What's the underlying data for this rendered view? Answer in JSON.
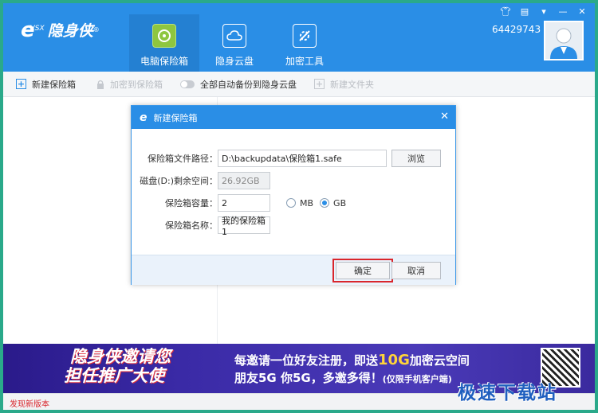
{
  "app": {
    "logo_e": "e",
    "logo_small": "VSX",
    "logo_text": "隐身侠",
    "logo_reg": "®",
    "user_id": "64429743"
  },
  "nav": [
    {
      "label": "电脑保险箱",
      "icon": "safe-icon",
      "active": true
    },
    {
      "label": "隐身云盘",
      "icon": "cloud-icon",
      "active": false
    },
    {
      "label": "加密工具",
      "icon": "tools-icon",
      "active": false
    }
  ],
  "window_controls": [
    "shirt-icon",
    "message-icon",
    "dropdown-icon",
    "minimize-icon",
    "close-icon"
  ],
  "toolbar": {
    "new_safe": "新建保险箱",
    "add_to_safe": "加密到保险箱",
    "auto_backup": "全部自动备份到隐身云盘",
    "new_folder": "新建文件夹"
  },
  "dialog": {
    "title": "新建保险箱",
    "path_label": "保险箱文件路径：",
    "path_value": "D:\\backupdata\\保险箱1.safe",
    "browse": "浏览",
    "disk_label": "磁盘(D:)剩余空间：",
    "disk_value": "26.92GB",
    "capacity_label": "保险箱容量：",
    "capacity_value": "2",
    "unit_mb": "MB",
    "unit_gb": "GB",
    "name_label": "保险箱名称：",
    "name_value": "我的保险箱1",
    "ok": "确定",
    "cancel": "取消"
  },
  "banner": {
    "slogan_1": "隐身侠邀请您",
    "slogan_2": "担任推广大使",
    "line1_a": "每邀请一位好友注册，即送",
    "line1_b": "10G",
    "line1_c": "加密云空间",
    "line2_a": "朋友5G  你5G，多邀多得！",
    "line2_b": "(仅限手机客户端)"
  },
  "status": {
    "new_version": "发现新版本"
  },
  "watermark": "极速下载站",
  "colors": {
    "header": "#2a8ee6",
    "accent_green": "#8ec63f",
    "highlight_red": "#d9262c",
    "frame": "#2aa98a"
  }
}
